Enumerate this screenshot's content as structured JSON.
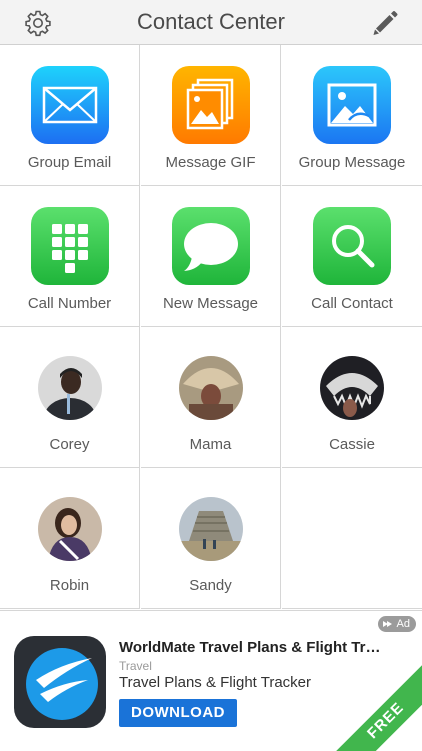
{
  "header": {
    "title": "Contact Center",
    "left_icon": "gear-icon",
    "right_icon": "pencil-icon"
  },
  "tiles": [
    {
      "label": "Group Email",
      "icon": "envelope-icon"
    },
    {
      "label": "Message GIF",
      "icon": "photo-stack-icon"
    },
    {
      "label": "Group Message",
      "icon": "picture-frame-icon"
    },
    {
      "label": "Call Number",
      "icon": "dialpad-icon"
    },
    {
      "label": "New Message",
      "icon": "speech-bubble-icon"
    },
    {
      "label": "Call Contact",
      "icon": "magnifier-icon"
    }
  ],
  "contacts": [
    {
      "name": "Corey"
    },
    {
      "name": "Mama"
    },
    {
      "name": "Cassie"
    },
    {
      "name": "Robin"
    },
    {
      "name": "Sandy"
    }
  ],
  "ad": {
    "tag": "Ad",
    "app_title": "WorldMate Travel Plans & Flight Tr…",
    "category": "Travel",
    "subtitle": "Travel Plans & Flight Tracker",
    "button": "DOWNLOAD",
    "ribbon": "FREE"
  },
  "colors": {
    "header_bg": "#f3f3f3",
    "grid_line": "#d6d6d6",
    "download_blue": "#1a73d8",
    "free_green": "#41b64d"
  }
}
